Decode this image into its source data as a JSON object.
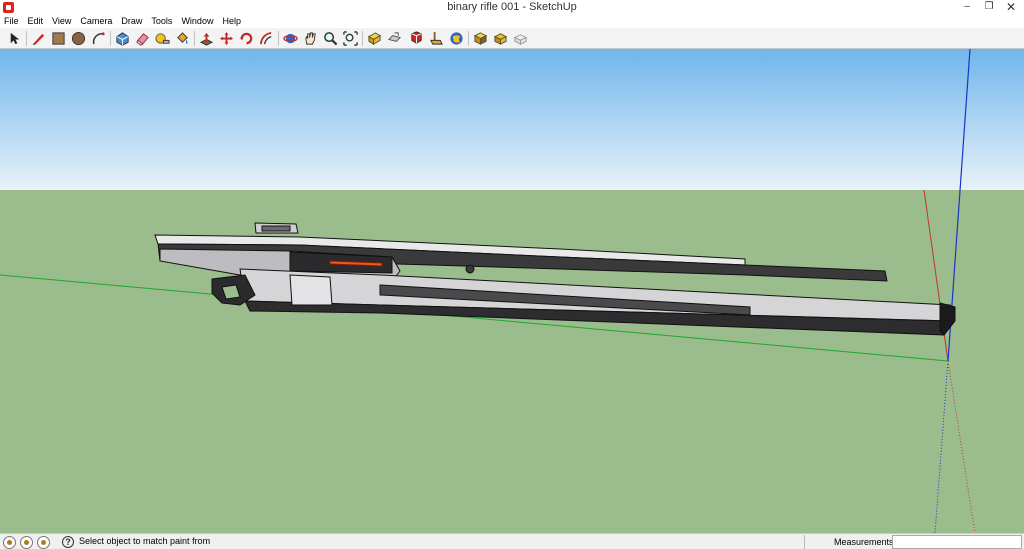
{
  "window": {
    "title": "binary rifle 001 - SketchUp",
    "controls": {
      "minimize": "‒",
      "maximize": "❐",
      "close": "✕"
    }
  },
  "menu": {
    "items": [
      "File",
      "Edit",
      "View",
      "Camera",
      "Draw",
      "Tools",
      "Window",
      "Help"
    ]
  },
  "toolbar": {
    "tools": [
      {
        "name": "select-tool-icon"
      },
      {
        "name": "pencil-line-tool-icon"
      },
      {
        "name": "rectangle-tool-icon"
      },
      {
        "name": "circle-tool-icon"
      },
      {
        "name": "arc-tool-icon"
      },
      {
        "name": "make-component-icon"
      },
      {
        "name": "eraser-tool-icon"
      },
      {
        "name": "tape-measure-tool-icon"
      },
      {
        "name": "paint-bucket-tool-icon"
      },
      {
        "name": "push-pull-tool-icon"
      },
      {
        "name": "move-tool-icon"
      },
      {
        "name": "rotate-tool-icon"
      },
      {
        "name": "offset-tool-icon"
      },
      {
        "name": "orbit-tool-icon"
      },
      {
        "name": "pan-tool-icon"
      },
      {
        "name": "zoom-tool-icon"
      },
      {
        "name": "zoom-extents-icon"
      },
      {
        "name": "warehouse-icon"
      },
      {
        "name": "share-model-icon"
      },
      {
        "name": "get-models-icon"
      },
      {
        "name": "extension-warehouse-icon"
      },
      {
        "name": "add-location-icon"
      },
      {
        "name": "section-plane-icon"
      },
      {
        "name": "layout-icon"
      }
    ]
  },
  "colors": {
    "sky_top": "#6fb6ec",
    "sky_bottom": "#e8f2f8",
    "ground": "#9bbd8d",
    "axis_red": "#c0392b",
    "axis_green": "#1fa82b",
    "axis_blue": "#1c34c9",
    "accent_orange": "#f2581a"
  },
  "status": {
    "message": "Select object to match paint from",
    "help_symbol": "?",
    "measurements_label": "Measurements",
    "measurements_value": ""
  }
}
